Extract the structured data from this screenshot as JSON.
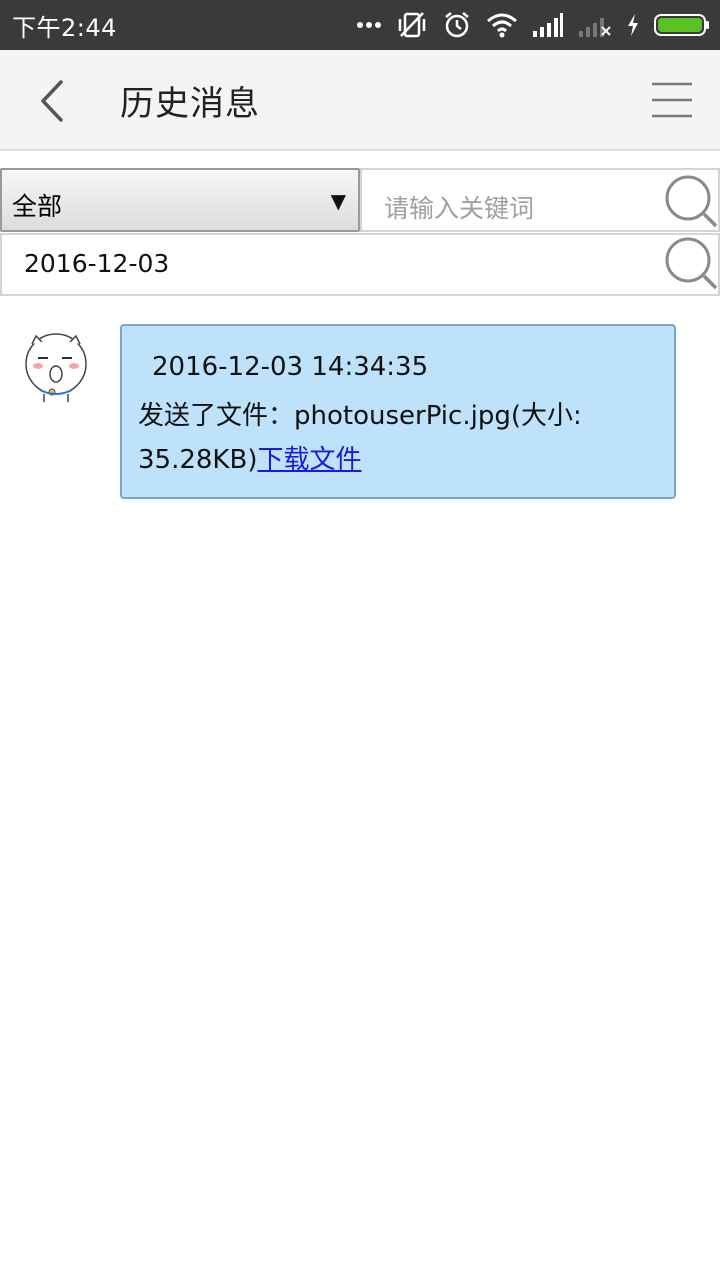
{
  "status_bar": {
    "time": "下午2:44"
  },
  "header": {
    "title": "历史消息"
  },
  "filter": {
    "type_selected": "全部",
    "keyword_placeholder": "请输入关键词",
    "date_value": "2016-12-03"
  },
  "messages": [
    {
      "timestamp": "2016-12-03 14:34:35",
      "text_prefix": "发送了文件：photouserPic.jpg(大小: 35.28KB)",
      "link_label": "下载文件"
    }
  ],
  "colors": {
    "status_bar_bg": "#3a3a3a",
    "title_bar_bg": "#f4f4f4",
    "bubble_bg": "#bfe2fb",
    "link": "#1a1adb",
    "battery": "#58c322"
  },
  "icons": [
    "more-dots-icon",
    "vibrate-off-icon",
    "alarm-icon",
    "wifi-icon",
    "signal-icon",
    "signal-no-sim-icon",
    "charging-icon",
    "battery-icon",
    "back-arrow-icon",
    "menu-icon",
    "search-icon"
  ]
}
